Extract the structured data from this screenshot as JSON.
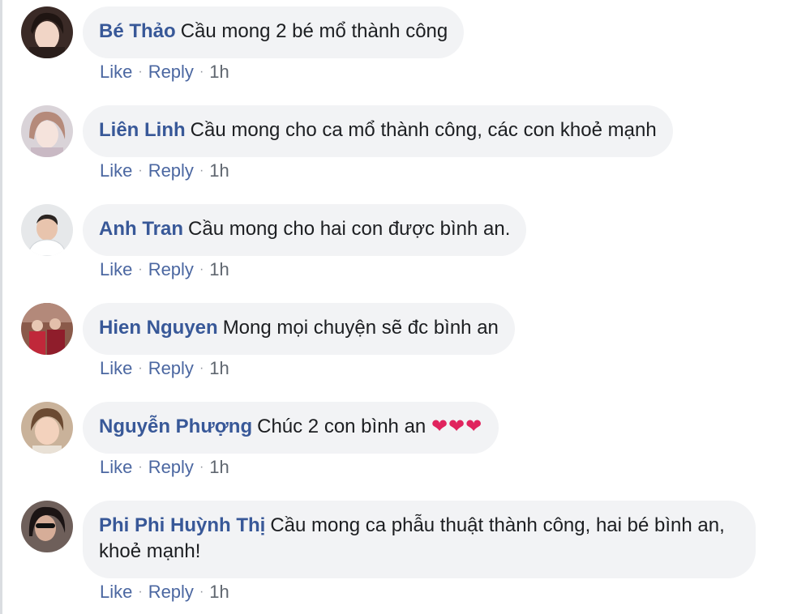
{
  "comments": [
    {
      "author": "Bé Thảo",
      "text": "Cầu mong 2 bé mổ thành công",
      "like_label": "Like",
      "reply_label": "Reply",
      "time": "1h",
      "avatar_icon": "avatar-photo"
    },
    {
      "author": "Liên Linh",
      "text": "Cầu mong cho ca mổ thành công, các con khoẻ mạnh",
      "like_label": "Like",
      "reply_label": "Reply",
      "time": "1h",
      "avatar_icon": "avatar-photo"
    },
    {
      "author": "Anh Tran",
      "text": "Cầu mong cho hai con được bình an.",
      "like_label": "Like",
      "reply_label": "Reply",
      "time": "1h",
      "avatar_icon": "avatar-photo"
    },
    {
      "author": "Hien Nguyen",
      "text": "Mong mọi chuyện sẽ đc bình an",
      "like_label": "Like",
      "reply_label": "Reply",
      "time": "1h",
      "avatar_icon": "avatar-photo"
    },
    {
      "author": "Nguyễn Phượng",
      "text": "Chúc 2 con bình an",
      "emoji": "❤❤❤",
      "like_label": "Like",
      "reply_label": "Reply",
      "time": "1h",
      "avatar_icon": "avatar-photo"
    },
    {
      "author": "Phi Phi Huỳnh Thị",
      "text": "Cầu mong ca phẫu thuật thành công, hai bé bình an, khoẻ mạnh!",
      "like_label": "Like",
      "reply_label": "Reply",
      "time": "1h",
      "avatar_icon": "avatar-photo"
    }
  ],
  "colors": {
    "author": "#385898",
    "bubble": "#f2f3f5",
    "action_link": "#4b67a1",
    "heart": "#e0245e"
  }
}
